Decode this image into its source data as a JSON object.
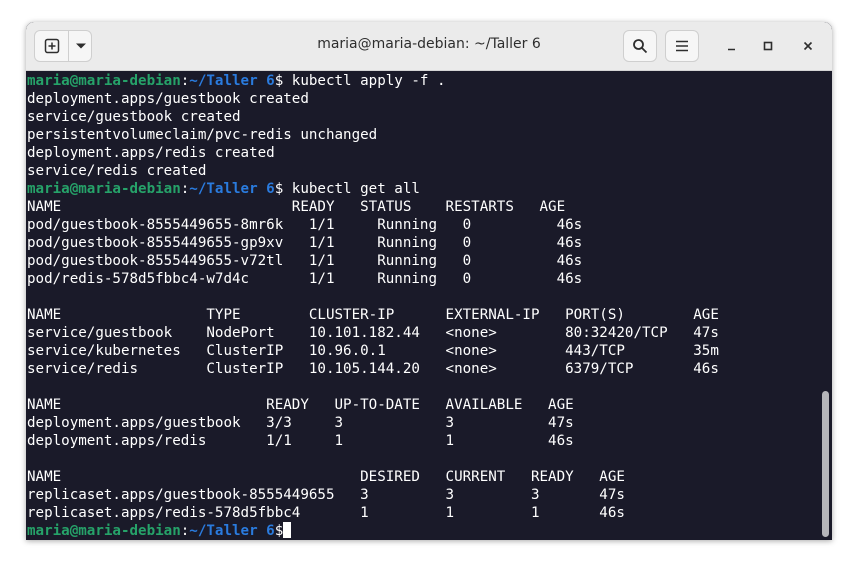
{
  "window": {
    "title": "maria@maria-debian: ~/Taller 6"
  },
  "terminal": {
    "prompt": {
      "user": "maria@maria-debian",
      "sep": ":",
      "path": "~/Taller 6",
      "symbol": "$"
    },
    "lines": [
      {
        "kind": "prompt",
        "cmd": " kubectl apply -f ."
      },
      {
        "kind": "out",
        "text": "deployment.apps/guestbook created"
      },
      {
        "kind": "out",
        "text": "service/guestbook created"
      },
      {
        "kind": "out",
        "text": "persistentvolumeclaim/pvc-redis unchanged"
      },
      {
        "kind": "out",
        "text": "deployment.apps/redis created"
      },
      {
        "kind": "out",
        "text": "service/redis created"
      },
      {
        "kind": "prompt",
        "cmd": " kubectl get all"
      },
      {
        "kind": "out",
        "text": "NAME                           READY   STATUS    RESTARTS   AGE"
      },
      {
        "kind": "out",
        "text": "pod/guestbook-8555449655-8mr6k   1/1     Running   0          46s"
      },
      {
        "kind": "out",
        "text": "pod/guestbook-8555449655-gp9xv   1/1     Running   0          46s"
      },
      {
        "kind": "out",
        "text": "pod/guestbook-8555449655-v72tl   1/1     Running   0          46s"
      },
      {
        "kind": "out",
        "text": "pod/redis-578d5fbbc4-w7d4c       1/1     Running   0          46s"
      },
      {
        "kind": "out",
        "text": ""
      },
      {
        "kind": "out",
        "text": "NAME                 TYPE        CLUSTER-IP      EXTERNAL-IP   PORT(S)        AGE"
      },
      {
        "kind": "out",
        "text": "service/guestbook    NodePort    10.101.182.44   <none>        80:32420/TCP   47s"
      },
      {
        "kind": "out",
        "text": "service/kubernetes   ClusterIP   10.96.0.1       <none>        443/TCP        35m"
      },
      {
        "kind": "out",
        "text": "service/redis        ClusterIP   10.105.144.20   <none>        6379/TCP       46s"
      },
      {
        "kind": "out",
        "text": ""
      },
      {
        "kind": "out",
        "text": "NAME                        READY   UP-TO-DATE   AVAILABLE   AGE"
      },
      {
        "kind": "out",
        "text": "deployment.apps/guestbook   3/3     3            3           47s"
      },
      {
        "kind": "out",
        "text": "deployment.apps/redis       1/1     1            1           46s"
      },
      {
        "kind": "out",
        "text": ""
      },
      {
        "kind": "out",
        "text": "NAME                                   DESIRED   CURRENT   READY   AGE"
      },
      {
        "kind": "out",
        "text": "replicaset.apps/guestbook-8555449655   3         3         3       47s"
      },
      {
        "kind": "out",
        "text": "replicaset.apps/redis-578d5fbbc4       1         1         1       46s"
      },
      {
        "kind": "prompt",
        "cmd": ""
      }
    ]
  },
  "colors": {
    "prompt_user": "#26a269",
    "prompt_path": "#2a7bde",
    "terminal_bg": "#1a1a29",
    "text": "#ffffff"
  },
  "icons": [
    "new-tab-icon",
    "chevron-down-icon",
    "search-icon",
    "hamburger-menu-icon",
    "minimize-icon",
    "maximize-icon",
    "close-icon"
  ]
}
